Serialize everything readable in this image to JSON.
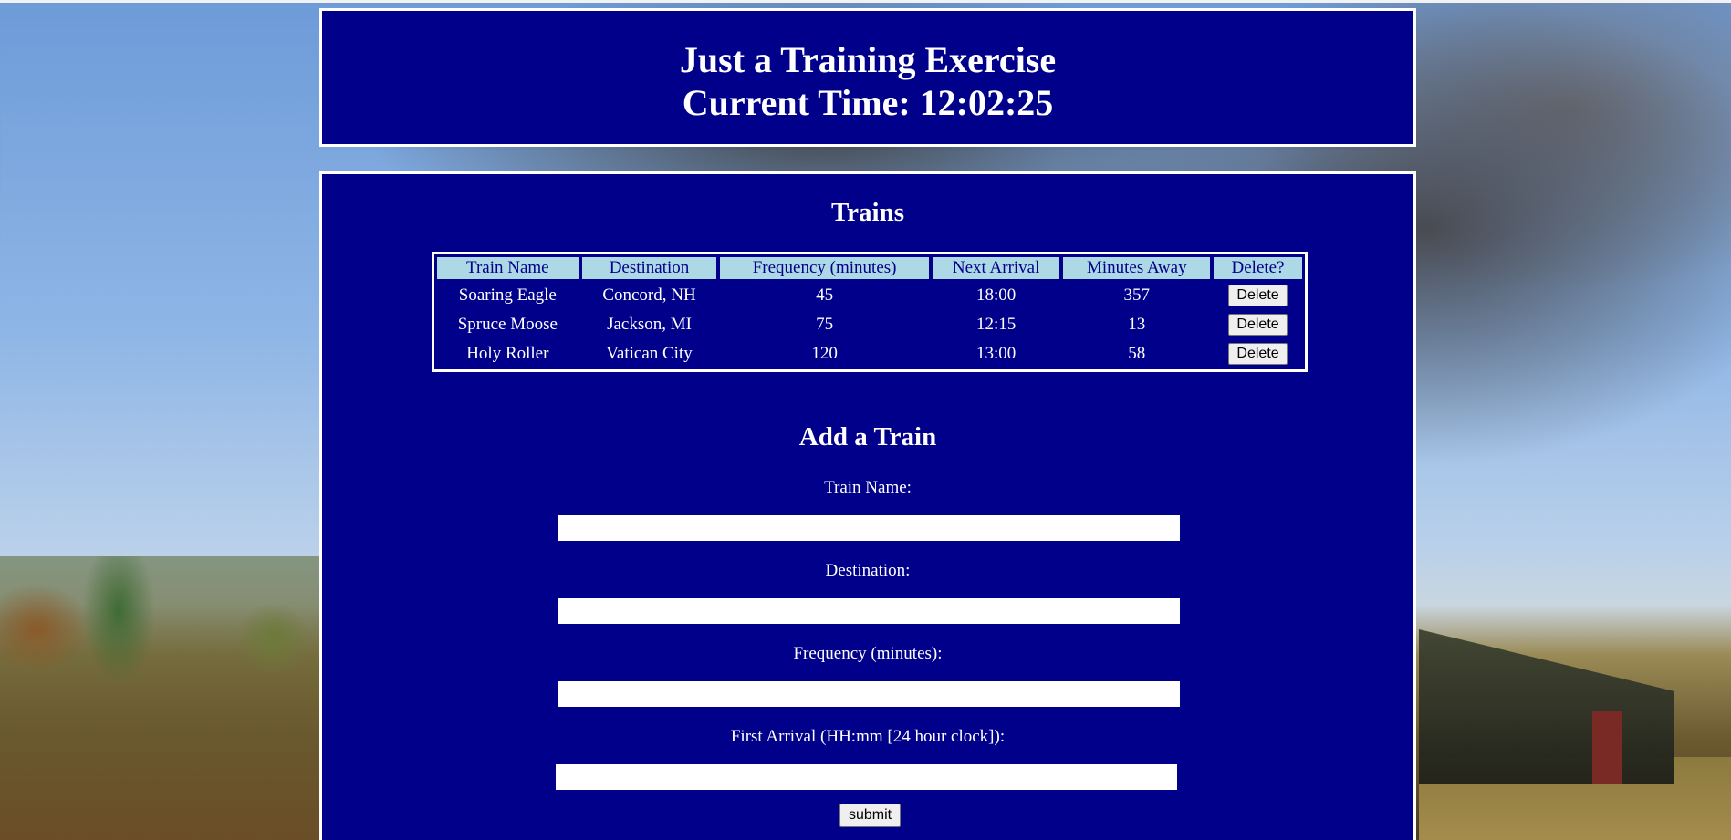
{
  "header": {
    "title": "Just a Training Exercise",
    "time_label": "Current Time: 12:02:25"
  },
  "trains_section": {
    "title": "Trains",
    "columns": [
      "Train Name",
      "Destination",
      "Frequency (minutes)",
      "Next Arrival",
      "Minutes Away",
      "Delete?"
    ],
    "rows": [
      {
        "name": "Soaring Eagle",
        "destination": "Concord, NH",
        "frequency": "45",
        "next_arrival": "18:00",
        "minutes_away": "357",
        "delete_label": "Delete"
      },
      {
        "name": "Spruce Moose",
        "destination": "Jackson, MI",
        "frequency": "75",
        "next_arrival": "12:15",
        "minutes_away": "13",
        "delete_label": "Delete"
      },
      {
        "name": "Holy Roller",
        "destination": "Vatican City",
        "frequency": "120",
        "next_arrival": "13:00",
        "minutes_away": "58",
        "delete_label": "Delete"
      }
    ]
  },
  "add_form": {
    "title": "Add a Train",
    "train_name_label": "Train Name:",
    "train_name_value": "",
    "destination_label": "Destination:",
    "destination_value": "",
    "frequency_label": "Frequency (minutes):",
    "frequency_value": "",
    "first_arrival_label": "First Arrival (HH:mm [24 hour clock]):",
    "first_arrival_value": "",
    "submit_label": "submit"
  },
  "colors": {
    "panel_bg": "#00008b",
    "header_row_bg": "#add8e6",
    "border": "#ffffff"
  }
}
